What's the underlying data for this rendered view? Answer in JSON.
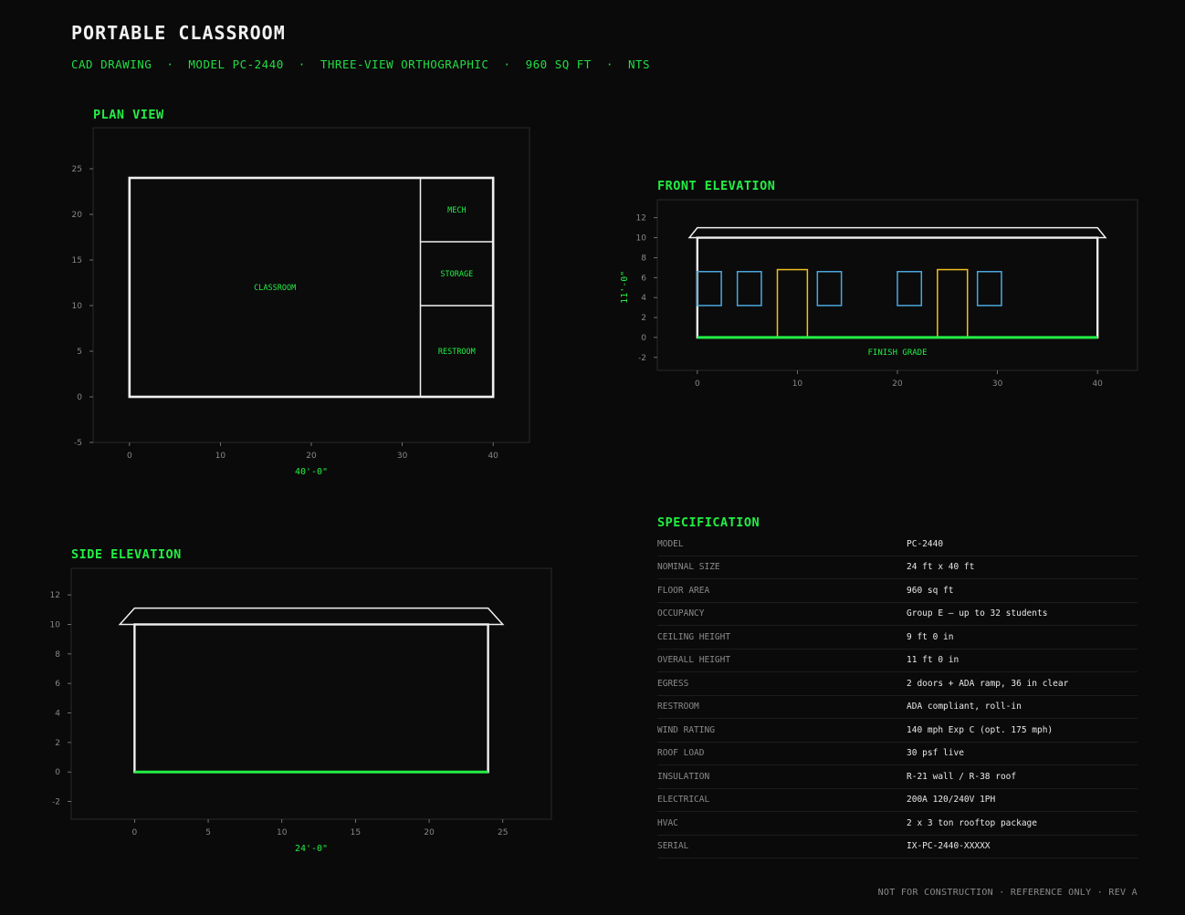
{
  "header": {
    "title": "PORTABLE CLASSROOM",
    "subtitle": "CAD DRAWING  ·  MODEL PC-2440  ·  THREE-VIEW ORTHOGRAPHIC  ·  960 SQ FT  ·  NTS"
  },
  "colors": {
    "background": "#0a0a0a",
    "accent_green": "#22ee44",
    "outline": "#f0f0f0",
    "window_blue": "#4aa8e0",
    "door_yellow": "#f0c020",
    "axis_gray": "#888888",
    "frame_gray": "#2a2a2a"
  },
  "plan": {
    "title": "PLAN VIEW",
    "dimension": "40'-0\"",
    "x_ticks": [
      0,
      10,
      20,
      30,
      40
    ],
    "y_ticks": [
      -5,
      0,
      5,
      10,
      15,
      20,
      25
    ],
    "xlim": [
      -4,
      44
    ],
    "ylim": [
      -5,
      29.5
    ],
    "outline": {
      "x0": 0,
      "y0": 0,
      "x1": 40,
      "y1": 24
    },
    "rooms": [
      {
        "name": "CLASSROOM",
        "x0": 0,
        "y0": 0,
        "x1": 32,
        "y1": 24
      },
      {
        "name": "MECH",
        "x0": 32,
        "y0": 17,
        "x1": 40,
        "y1": 24
      },
      {
        "name": "STORAGE",
        "x0": 32,
        "y0": 10,
        "x1": 40,
        "y1": 17
      },
      {
        "name": "RESTROOM",
        "x0": 32,
        "y0": 0,
        "x1": 40,
        "y1": 10
      }
    ]
  },
  "front": {
    "title": "FRONT ELEVATION",
    "height_dimension": "11'-0\"",
    "grade_label": "FINISH GRADE",
    "x_ticks": [
      0,
      10,
      20,
      30,
      40
    ],
    "y_ticks": [
      -2,
      0,
      2,
      4,
      6,
      8,
      10,
      12
    ],
    "xlim": [
      -4,
      44
    ],
    "ylim": [
      -3.3,
      13.8
    ],
    "wall": {
      "x0": 0,
      "x1": 40,
      "y0": 0,
      "y1": 10
    },
    "roof": {
      "x0": -0.8,
      "x1": 40.8,
      "top_x0": 0,
      "top_x1": 40,
      "y0": 10,
      "y1": 11
    },
    "windows": [
      {
        "x0": 0,
        "x1": 2.4,
        "y0": 3.2,
        "y1": 6.6
      },
      {
        "x0": 4,
        "x1": 6.4,
        "y0": 3.2,
        "y1": 6.6
      },
      {
        "x0": 12,
        "x1": 14.4,
        "y0": 3.2,
        "y1": 6.6
      },
      {
        "x0": 20,
        "x1": 22.4,
        "y0": 3.2,
        "y1": 6.6
      },
      {
        "x0": 28,
        "x1": 30.4,
        "y0": 3.2,
        "y1": 6.6
      }
    ],
    "doors": [
      {
        "x0": 8,
        "x1": 11,
        "y0": 0,
        "y1": 6.8
      },
      {
        "x0": 24,
        "x1": 27,
        "y0": 0,
        "y1": 6.8
      }
    ]
  },
  "side": {
    "title": "SIDE ELEVATION",
    "dimension": "24'-0\"",
    "x_ticks": [
      0,
      5,
      10,
      15,
      20,
      25
    ],
    "y_ticks": [
      -2,
      0,
      2,
      4,
      6,
      8,
      10,
      12
    ],
    "xlim": [
      -4.3,
      28.3
    ],
    "ylim": [
      -3.2,
      13.8
    ],
    "wall": {
      "x0": 0,
      "x1": 24,
      "y0": 0,
      "y1": 10
    },
    "roof": {
      "x0": -1,
      "x1": 25,
      "top_x0": 0,
      "top_x1": 24,
      "y0": 10,
      "y1": 11.1
    }
  },
  "spec": {
    "title": "SPECIFICATION",
    "rows": [
      {
        "key": "MODEL",
        "value": "PC-2440"
      },
      {
        "key": "NOMINAL SIZE",
        "value": "24 ft x 40 ft"
      },
      {
        "key": "FLOOR AREA",
        "value": "960 sq ft"
      },
      {
        "key": "OCCUPANCY",
        "value": "Group E — up to 32 students"
      },
      {
        "key": "CEILING HEIGHT",
        "value": "9 ft 0 in"
      },
      {
        "key": "OVERALL HEIGHT",
        "value": "11 ft 0 in"
      },
      {
        "key": "EGRESS",
        "value": "2 doors + ADA ramp, 36 in clear"
      },
      {
        "key": "RESTROOM",
        "value": "ADA compliant, roll-in"
      },
      {
        "key": "WIND RATING",
        "value": "140 mph Exp C (opt. 175 mph)"
      },
      {
        "key": "ROOF LOAD",
        "value": "30 psf live"
      },
      {
        "key": "INSULATION",
        "value": "R-21 wall / R-38 roof"
      },
      {
        "key": "ELECTRICAL",
        "value": "200A 120/240V 1PH"
      },
      {
        "key": "HVAC",
        "value": "2 x 3 ton rooftop package"
      },
      {
        "key": "SERIAL",
        "value": "IX-PC-2440-XXXXX"
      }
    ]
  },
  "footer": "NOT FOR CONSTRUCTION · REFERENCE ONLY · REV A"
}
